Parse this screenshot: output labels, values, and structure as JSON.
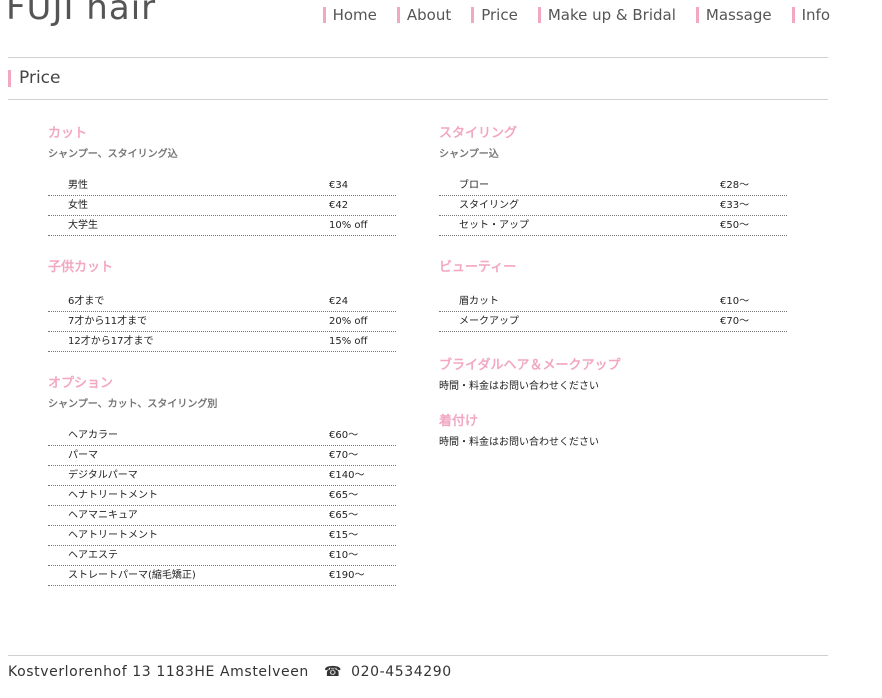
{
  "brand": {
    "logo": "FUJI hair"
  },
  "nav": [
    {
      "label": "Home"
    },
    {
      "label": "About"
    },
    {
      "label": "Price"
    },
    {
      "label": "Make up & Bridal"
    },
    {
      "label": "Massage"
    },
    {
      "label": "Info"
    }
  ],
  "page": {
    "title": "Price"
  },
  "left": [
    {
      "title": "カット",
      "subtitle": "シャンプー、スタイリング込",
      "rows": [
        {
          "name": "男性",
          "price": "€34"
        },
        {
          "name": "女性",
          "price": "€42"
        },
        {
          "name": "大学生",
          "price": "10% off"
        }
      ]
    },
    {
      "title": "子供カット",
      "subtitle": "",
      "rows": [
        {
          "name": "6才まで",
          "price": "€24"
        },
        {
          "name": "7才から11才まで",
          "price": "20% off"
        },
        {
          "name": "12才から17才まで",
          "price": "15% off"
        }
      ]
    },
    {
      "title": "オプション",
      "subtitle": "シャンプー、カット、スタイリング別",
      "rows": [
        {
          "name": "ヘアカラー",
          "price": "€60〜"
        },
        {
          "name": "パーマ",
          "price": "€70〜"
        },
        {
          "name": "デジタルパーマ",
          "price": "€140〜"
        },
        {
          "name": "ヘナトリートメント",
          "price": "€65〜"
        },
        {
          "name": "ヘアマニキュア",
          "price": "€65〜"
        },
        {
          "name": "ヘアトリートメント",
          "price": "€15〜"
        },
        {
          "name": "ヘアエステ",
          "price": "€10〜"
        },
        {
          "name": "ストレートパーマ(縮毛矯正)",
          "price": "€190〜"
        }
      ]
    }
  ],
  "right": [
    {
      "title": "スタイリング",
      "subtitle": "シャンプー込",
      "rows": [
        {
          "name": "ブロー",
          "price": "€28〜"
        },
        {
          "name": "スタイリング",
          "price": "€33〜"
        },
        {
          "name": "セット・アップ",
          "price": "€50〜"
        }
      ]
    },
    {
      "title": "ビューティー",
      "subtitle": "",
      "rows": [
        {
          "name": "眉カット",
          "price": "€10〜"
        },
        {
          "name": "メークアップ",
          "price": "€70〜"
        }
      ]
    },
    {
      "title": "ブライダルヘア＆メークアップ",
      "note": "時間・料金はお問い合わせください"
    },
    {
      "title": "着付け",
      "note": "時間・料金はお問い合わせください"
    }
  ],
  "footer": {
    "address": "Kostverlorenhof 13  1183HE  Amstelveen",
    "phone_icon": "☎",
    "phone": "020-4534290"
  },
  "colors": {
    "accent": "#f2a7c2",
    "rule": "#d0d0d0"
  }
}
